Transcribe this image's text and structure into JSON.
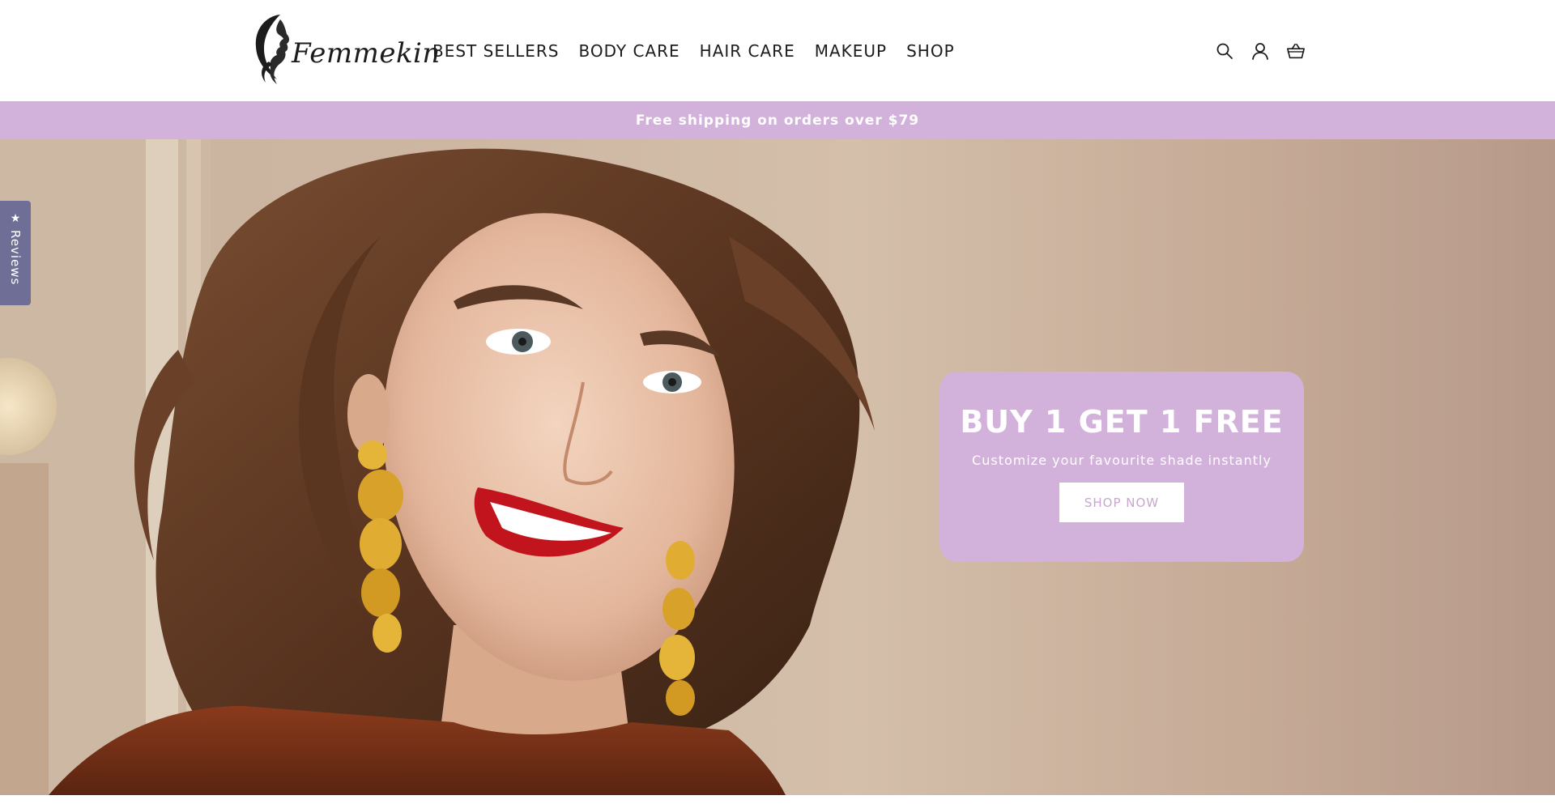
{
  "header": {
    "logo_text": "Femmekin",
    "nav": [
      {
        "label": "BEST SELLERS"
      },
      {
        "label": "BODY CARE"
      },
      {
        "label": "HAIR CARE"
      },
      {
        "label": "MAKEUP"
      },
      {
        "label": "SHOP"
      }
    ],
    "icons": [
      "search-icon",
      "account-icon",
      "cart-icon"
    ]
  },
  "announcement": {
    "text": "Free shipping on orders over $79",
    "background": "#d2b2da"
  },
  "hero": {
    "promo": {
      "title": "BUY 1 GET 1 FREE",
      "subtitle": "Customize your favourite shade instantly",
      "button_label": "SHOP NOW",
      "background": "#d2b2da"
    }
  },
  "reviews_tab": {
    "label": "Reviews",
    "icon": "star-icon",
    "background": "#6e6e96"
  }
}
